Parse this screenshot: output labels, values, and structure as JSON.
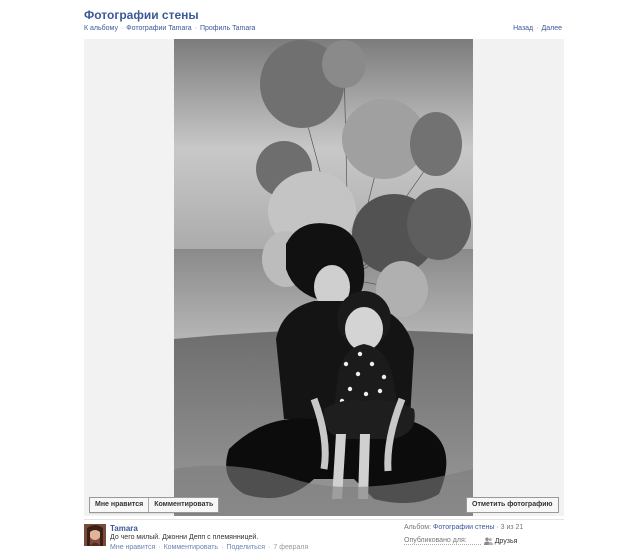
{
  "header": {
    "title": "Фотографии стены"
  },
  "breadcrumbs": [
    {
      "label": "К альбому"
    },
    {
      "label": "Фотографии Tamara"
    },
    {
      "label": "Профиль Tamara"
    }
  ],
  "pager": {
    "back": "Назад",
    "next": "Далее"
  },
  "photo_actions": {
    "like": "Мне нравится",
    "comment": "Комментировать",
    "tag": "Отметить фотографию"
  },
  "post": {
    "author": "Tamara",
    "caption": "До чего милый. Джонни Депп с племянницей.",
    "actions": {
      "like": "Мне нравится",
      "comment": "Комментировать",
      "share": "Поделиться"
    },
    "date": "7 февраля"
  },
  "album": {
    "label": "Альбом:",
    "name": "Фотографии стены",
    "position": "3 из 21",
    "published_label": "Опубликовано для:",
    "audience": "Друзья"
  },
  "icons": {
    "audience": "friends-icon"
  },
  "colors": {
    "link": "#3b5998",
    "link_light": "#6d84b4"
  }
}
